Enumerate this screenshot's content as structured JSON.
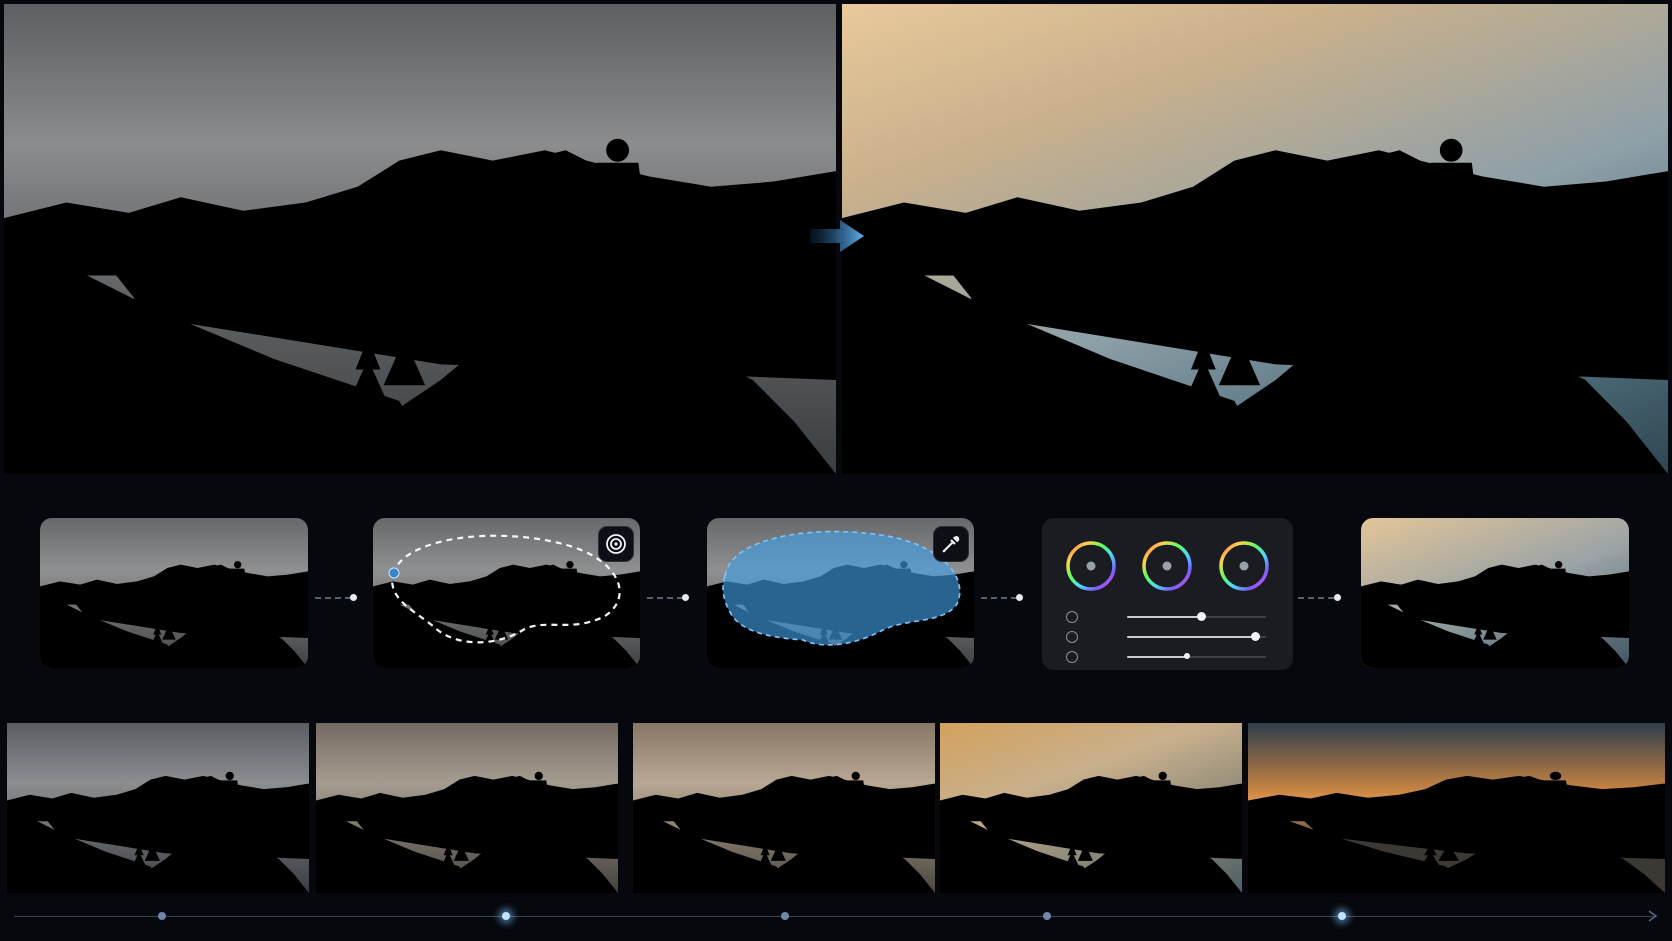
{
  "hero": {
    "before": {
      "grade": "desaturated-overcast"
    },
    "after": {
      "grade": "warm-golden-hour"
    },
    "transition_icon": "arrow-right-icon"
  },
  "pipeline": {
    "steps": [
      {
        "name": "original-photo",
        "tool_icon": null
      },
      {
        "name": "select-sky",
        "tool_icon": "target-icon"
      },
      {
        "name": "mask-sky",
        "tool_icon": "eyedropper-icon"
      },
      {
        "name": "color-grading",
        "tool_icon": null
      },
      {
        "name": "final-result",
        "tool_icon": null
      }
    ],
    "color_wheels": [
      "shadows-wheel",
      "midtones-wheel",
      "highlights-wheel"
    ],
    "sliders": [
      {
        "icon": "power-icon",
        "value": 0.53
      },
      {
        "icon": "clock-icon",
        "value": 0.92
      },
      {
        "icon": "timer-icon",
        "value": 0.44
      }
    ]
  },
  "strip": {
    "frames": [
      {
        "grade": "cool-overcast"
      },
      {
        "grade": "muted-warm"
      },
      {
        "grade": "soft-warm"
      },
      {
        "grade": "golden"
      },
      {
        "grade": "dramatic-sunset"
      }
    ]
  },
  "timeline": {
    "markers": [
      {
        "position": 0.09,
        "active": false
      },
      {
        "position": 0.3,
        "active": true
      },
      {
        "position": 0.47,
        "active": false
      },
      {
        "position": 0.63,
        "active": false
      },
      {
        "position": 0.81,
        "active": true
      }
    ],
    "end_icon": "chevron-right-icon"
  },
  "colors": {
    "background": "#06080d",
    "accent_blue": "#4aa3e8",
    "marker_glow": "#bfe2ff"
  }
}
